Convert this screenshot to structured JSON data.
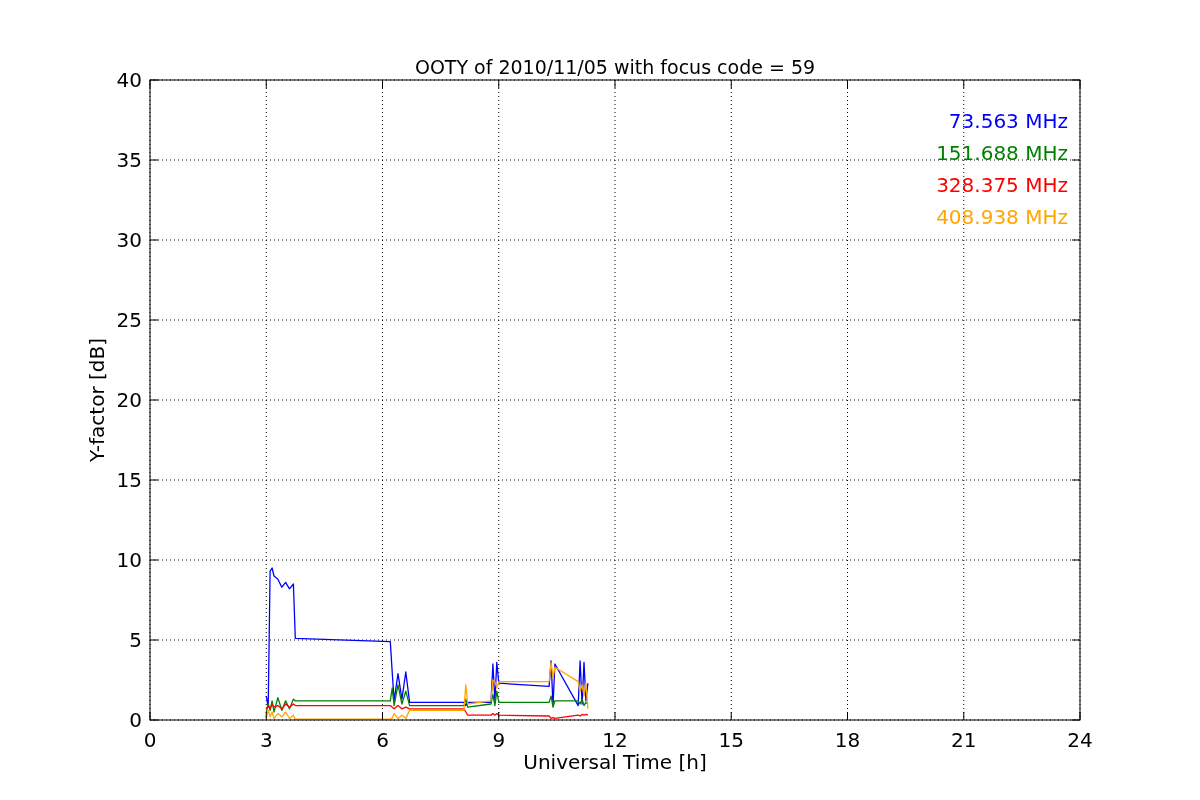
{
  "chart_data": {
    "type": "line",
    "title": "OOTY of 2010/11/05 with focus code = 59",
    "xlabel": "Universal Time [h]",
    "ylabel": "Y-factor [dB]",
    "x": [
      3.0,
      3.05,
      3.1,
      3.15,
      3.2,
      3.3,
      3.4,
      3.5,
      3.6,
      3.7,
      3.75,
      6.2,
      6.25,
      6.3,
      6.4,
      6.5,
      6.6,
      6.7,
      8.1,
      8.15,
      8.2,
      8.8,
      8.85,
      8.9,
      8.95,
      9.0,
      10.3,
      10.35,
      10.4,
      10.45,
      11.05,
      11.1,
      11.15,
      11.2,
      11.25,
      11.3
    ],
    "series": [
      {
        "name": "73.563 MHz",
        "color": "#0000ff",
        "values": [
          1.5,
          0.8,
          9.3,
          9.5,
          9.0,
          8.8,
          8.3,
          8.6,
          8.2,
          8.5,
          5.1,
          4.9,
          3.0,
          1.2,
          2.9,
          1.3,
          3.0,
          1.1,
          1.1,
          0.9,
          1.1,
          1.1,
          3.5,
          1.2,
          3.6,
          2.3,
          2.1,
          3.7,
          0.9,
          3.5,
          0.9,
          3.7,
          1.0,
          3.6,
          1.2,
          2.3
        ]
      },
      {
        "name": "151.688 MHz",
        "color": "#008000",
        "values": [
          0.5,
          1.0,
          0.6,
          1.2,
          0.5,
          1.4,
          0.6,
          1.2,
          0.7,
          1.3,
          1.2,
          1.2,
          2.0,
          0.9,
          2.2,
          1.0,
          1.8,
          0.9,
          0.9,
          1.3,
          0.8,
          1.0,
          1.6,
          0.9,
          1.8,
          1.1,
          1.1,
          1.5,
          0.8,
          1.2,
          1.2,
          1.0,
          1.3,
          0.9,
          1.1,
          1.0
        ]
      },
      {
        "name": "328.375 MHz",
        "color": "#ff0000",
        "values": [
          0.7,
          0.9,
          0.7,
          1.0,
          0.8,
          0.9,
          0.7,
          1.0,
          0.8,
          1.0,
          0.9,
          0.9,
          0.8,
          0.7,
          0.9,
          0.7,
          0.8,
          0.7,
          0.7,
          0.5,
          0.3,
          0.3,
          0.4,
          0.3,
          0.4,
          0.3,
          0.25,
          0.1,
          0.15,
          0.1,
          0.3,
          0.25,
          0.35,
          0.3,
          0.35,
          0.3
        ]
      },
      {
        "name": "408.938 MHz",
        "color": "#ffa500",
        "values": [
          0.1,
          0.6,
          0.2,
          0.5,
          0.1,
          0.4,
          0.2,
          0.5,
          0.1,
          0.3,
          0.05,
          0.05,
          0.1,
          0.4,
          0.1,
          0.3,
          0.1,
          0.6,
          0.6,
          2.2,
          1.0,
          1.2,
          2.5,
          2.4,
          2.0,
          2.4,
          2.4,
          3.6,
          2.6,
          3.3,
          2.4,
          1.8,
          2.2,
          1.5,
          2.3,
          0.7
        ]
      }
    ],
    "grid": true,
    "xlim": [
      0,
      24
    ],
    "ylim": [
      0,
      40
    ],
    "xticks": [
      0,
      3,
      6,
      9,
      12,
      15,
      18,
      21,
      24
    ],
    "yticks": [
      0,
      5,
      10,
      15,
      20,
      25,
      30,
      35,
      40
    ]
  }
}
